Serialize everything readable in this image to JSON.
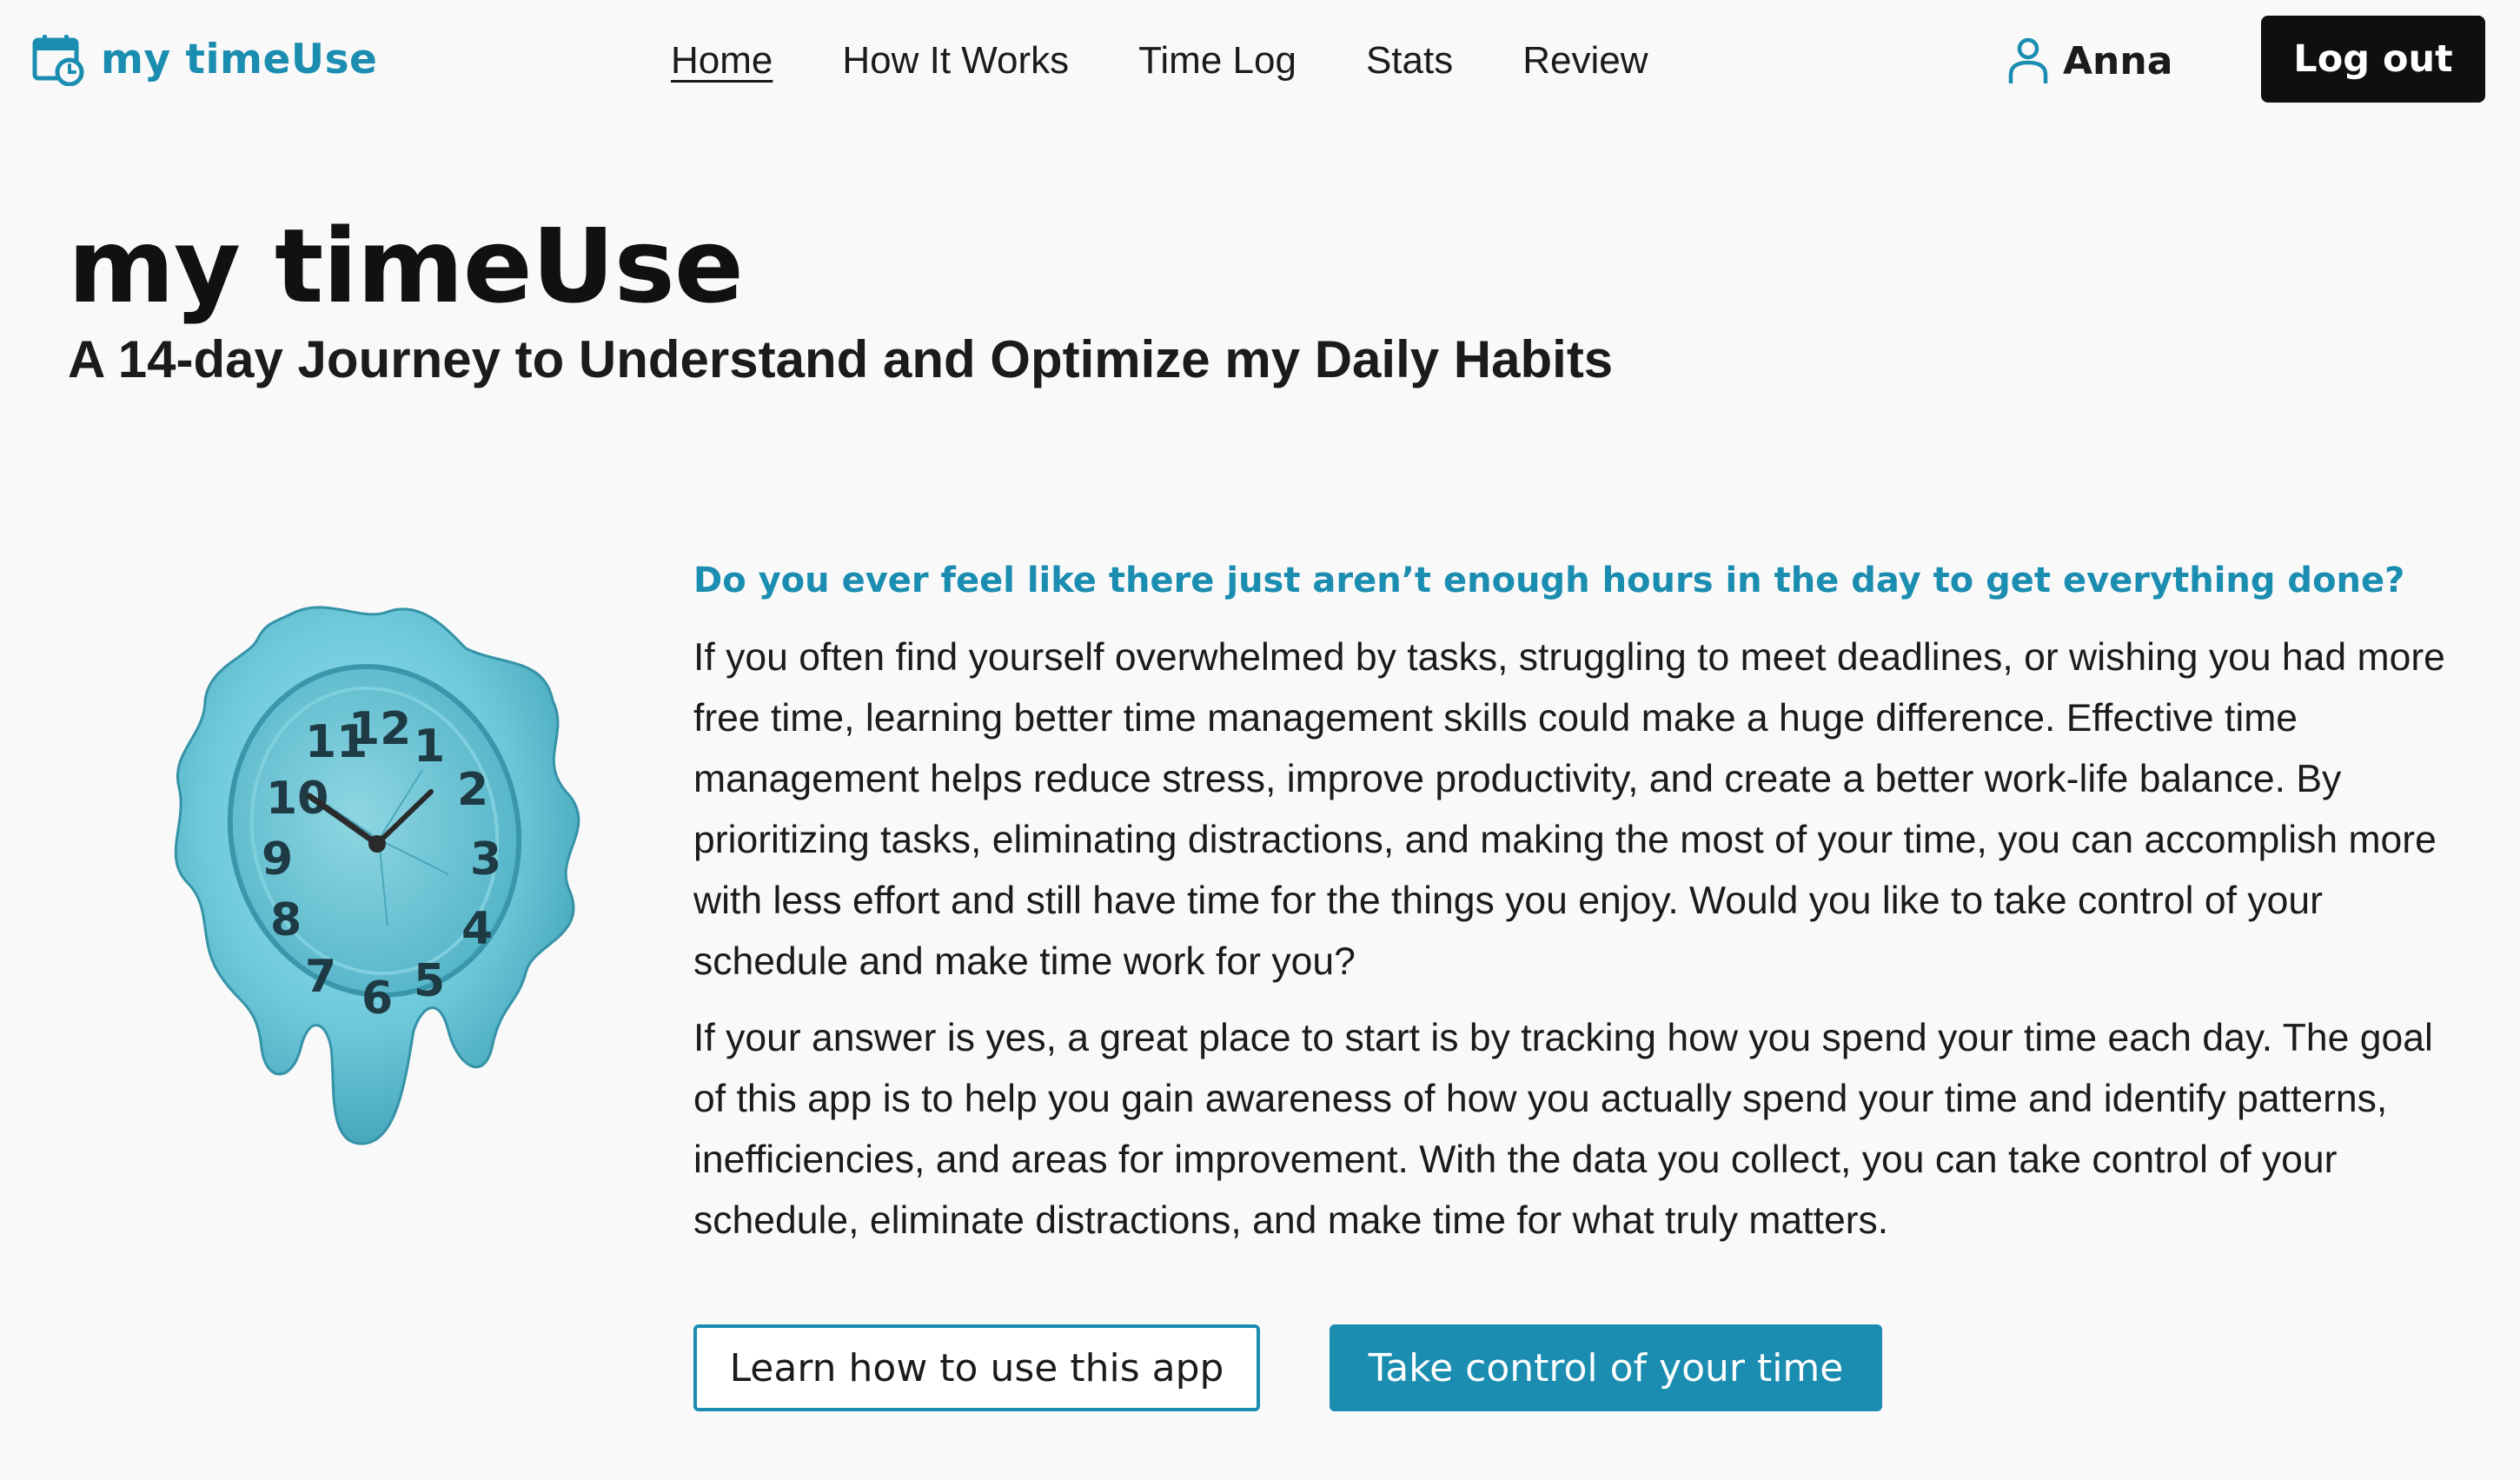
{
  "brand": {
    "name": "my timeUse",
    "icon": "calendar-clock-icon",
    "color": "#1a8db0"
  },
  "nav": {
    "links": [
      {
        "label": "Home",
        "active": true
      },
      {
        "label": "How It Works",
        "active": false
      },
      {
        "label": "Time Log",
        "active": false
      },
      {
        "label": "Stats",
        "active": false
      },
      {
        "label": "Review",
        "active": false
      }
    ]
  },
  "user": {
    "icon": "user-icon",
    "name": "Anna",
    "logout_label": "Log out"
  },
  "hero": {
    "title": "my timeUse",
    "subtitle": "A 14-day Journey to Understand and Optimize my Daily Habits"
  },
  "illustration": {
    "name": "melting-clock-image"
  },
  "content": {
    "question": "Do you ever feel like there just aren’t enough hours in the day to get everything done?",
    "paragraphs": [
      "If you often find yourself overwhelmed by tasks, struggling to meet deadlines, or wishing you had more free time, learning better time management skills could make a huge difference. Effective time management helps reduce stress, improve productivity, and create a better work-life balance. By prioritizing tasks, eliminating distractions, and making the most of your time, you can accomplish more with less effort and still have time for the things you enjoy. Would you like to take control of your schedule and make time work for you?",
      "If your answer is yes, a great place to start is by tracking how you spend your time each day. The goal of this app is to help you gain awareness of how you actually spend your time and identify patterns, inefficiencies, and areas for improvement. With the data you collect, you can take control of your schedule, eliminate distractions, and make time for what truly matters."
    ]
  },
  "actions": {
    "learn_label": "Learn how to use this app",
    "start_label": "Take control of your time"
  },
  "colors": {
    "accent": "#1a8db0",
    "background": "#f9f9fa",
    "dark_button": "#0f0f0f"
  }
}
